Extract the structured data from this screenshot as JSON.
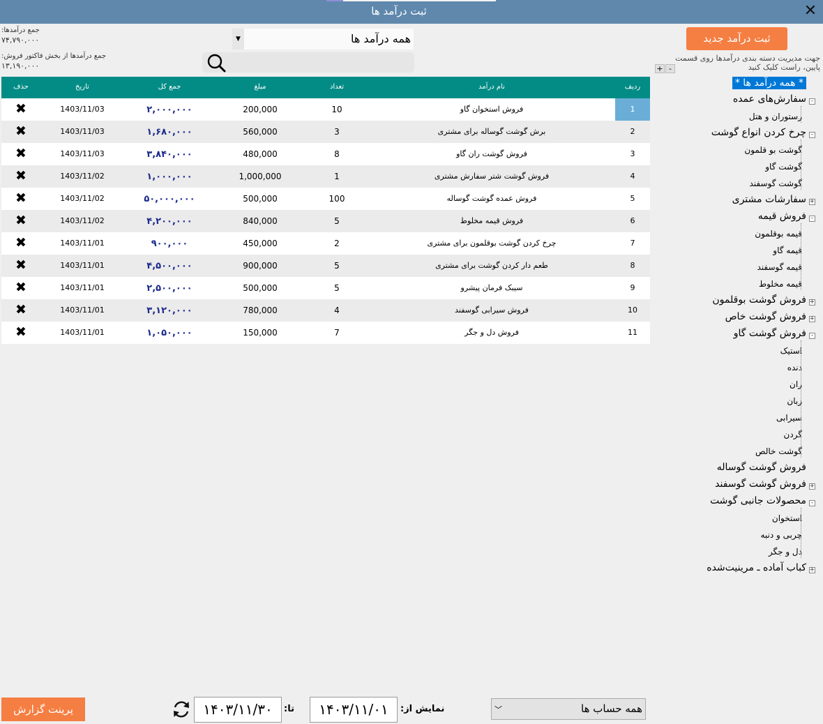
{
  "window": {
    "title": "ثبت درآمد ها",
    "close_icon": "close-icon"
  },
  "summary": {
    "total_label": "جمع درآمدها:",
    "total_value": "۷۴,۷۹۰,۰۰۰",
    "invoice_label": "جمع درآمدها از بخش فاکتور فروش:",
    "invoice_value": "۱۳,۱۹۰,۰۰۰"
  },
  "filter": {
    "category_value": "همه درآمد ها",
    "search_placeholder": ""
  },
  "actions": {
    "new_income": "ثبت درآمد جدید",
    "print_report": "پرینت گزارش"
  },
  "hint": "جهت مدیریت دسته بندی درآمدها روی قسمت پایین، راست کلیک کنید",
  "tree_buttons": {
    "expand": "+",
    "collapse": "-"
  },
  "table": {
    "headers": {
      "del": "حذف",
      "date": "تاریخ",
      "total": "جمع کل",
      "amount": "مبلغ",
      "count": "تعداد",
      "name": "نام درآمد",
      "idx": "ردیف"
    },
    "rows": [
      {
        "idx": "1",
        "name": "فروش استخوان گاو",
        "count": "10",
        "amount": "200,000",
        "total": "۲,۰۰۰,۰۰۰",
        "date": "1403/11/03",
        "del": "✖"
      },
      {
        "idx": "2",
        "name": "برش گوشت گوساله برای مشتری",
        "count": "3",
        "amount": "560,000",
        "total": "۱,۶۸۰,۰۰۰",
        "date": "1403/11/03",
        "del": "✖"
      },
      {
        "idx": "3",
        "name": "فروش گوشت ران گاو",
        "count": "8",
        "amount": "480,000",
        "total": "۳,۸۴۰,۰۰۰",
        "date": "1403/11/03",
        "del": "✖"
      },
      {
        "idx": "4",
        "name": "فروش گوشت شتر سفارش مشتری",
        "count": "1",
        "amount": "1,000,000",
        "total": "۱,۰۰۰,۰۰۰",
        "date": "1403/11/02",
        "del": "✖"
      },
      {
        "idx": "5",
        "name": "فروش عمده گوشت گوساله",
        "count": "100",
        "amount": "500,000",
        "total": "۵۰,۰۰۰,۰۰۰",
        "date": "1403/11/02",
        "del": "✖"
      },
      {
        "idx": "6",
        "name": "فروش قیمه مخلوط",
        "count": "5",
        "amount": "840,000",
        "total": "۴,۲۰۰,۰۰۰",
        "date": "1403/11/02",
        "del": "✖"
      },
      {
        "idx": "7",
        "name": "چرخ کردن گوشت بوقلمون برای مشتری",
        "count": "2",
        "amount": "450,000",
        "total": "۹۰۰,۰۰۰",
        "date": "1403/11/01",
        "del": "✖"
      },
      {
        "idx": "8",
        "name": "طعم دار کردن گوشت برای مشتری",
        "count": "5",
        "amount": "900,000",
        "total": "۴,۵۰۰,۰۰۰",
        "date": "1403/11/01",
        "del": "✖"
      },
      {
        "idx": "9",
        "name": "سیبک فرمان پیشرو",
        "count": "5",
        "amount": "500,000",
        "total": "۲,۵۰۰,۰۰۰",
        "date": "1403/11/01",
        "del": "✖"
      },
      {
        "idx": "10",
        "name": "فروش سیرابی گوسفند",
        "count": "4",
        "amount": "780,000",
        "total": "۳,۱۲۰,۰۰۰",
        "date": "1403/11/01",
        "del": "✖"
      },
      {
        "idx": "11",
        "name": "فروش دل و جگر",
        "count": "7",
        "amount": "150,000",
        "total": "۱,۰۵۰,۰۰۰",
        "date": "1403/11/01",
        "del": "✖"
      }
    ]
  },
  "tree": [
    {
      "label": "* همه درآمد ها *",
      "level": 0
    },
    {
      "label": "سفارش‌های عمده",
      "level": 1,
      "state": "-"
    },
    {
      "label": "رستوران و هتل",
      "level": 2
    },
    {
      "label": "چرخ کردن انواع گوشت",
      "level": 1,
      "state": "-"
    },
    {
      "label": "گوشت بو قلمون",
      "level": 2
    },
    {
      "label": "گوشت گاو",
      "level": 2
    },
    {
      "label": "گوشت گوسفند",
      "level": 2
    },
    {
      "label": "سفارشات مشتری",
      "level": 1,
      "state": "+"
    },
    {
      "label": "فروش قیمه",
      "level": 1,
      "state": "-"
    },
    {
      "label": "قیمه بوقلمون",
      "level": 2
    },
    {
      "label": "قیمه گاو",
      "level": 2
    },
    {
      "label": "قیمه گوسفند",
      "level": 2
    },
    {
      "label": "قیمه مخلوط",
      "level": 2
    },
    {
      "label": "فروش گوشت بوقلمون",
      "level": 1,
      "state": "+"
    },
    {
      "label": "فروش گوشت خاص",
      "level": 1,
      "state": "+"
    },
    {
      "label": "فروش گوشت گاو",
      "level": 1,
      "state": "-"
    },
    {
      "label": "استیک",
      "level": 2
    },
    {
      "label": "دنده",
      "level": 2
    },
    {
      "label": "ران",
      "level": 2
    },
    {
      "label": "زبان",
      "level": 2
    },
    {
      "label": "سیرابی",
      "level": 2
    },
    {
      "label": "گردن",
      "level": 2
    },
    {
      "label": "گوشت خالص",
      "level": 2
    },
    {
      "label": "فروش گوشت گوساله",
      "level": 1
    },
    {
      "label": "فروش گوشت گوسفند",
      "level": 1,
      "state": "+"
    },
    {
      "label": "محصولات جانبی گوشت",
      "level": 1,
      "state": "-"
    },
    {
      "label": "استخوان",
      "level": 2
    },
    {
      "label": "چربی و دنبه",
      "level": 2
    },
    {
      "label": "دل و جگر",
      "level": 2
    },
    {
      "label": "کباب آماده ـ مرینیت‌شده",
      "level": 1,
      "state": "+"
    }
  ],
  "footer": {
    "from_label": "نمایش از:",
    "from_value": "۱۴۰۳/۱۱/۰۱",
    "to_label": "تا:",
    "to_value": "۱۴۰۳/۱۱/۳۰",
    "account_value": "همه حساب ها"
  },
  "colors": {
    "titlebar": "#5f88ac",
    "header": "#038c86",
    "accent_button": "#f57e42",
    "selection": "#0078d7",
    "total_text": "#1c2a8c"
  }
}
